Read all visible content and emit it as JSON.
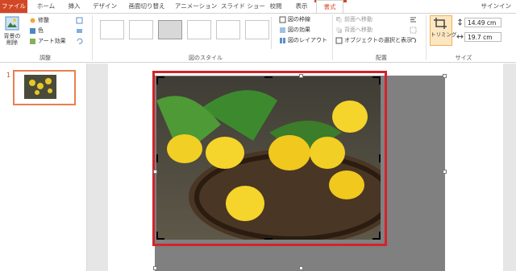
{
  "tabs": {
    "file": "ファイル",
    "home": "ホーム",
    "insert": "挿入",
    "design": "デザイン",
    "transitions": "画面切り替え",
    "animations": "アニメーション",
    "slideshow": "スライド ショー",
    "review": "校閲",
    "view": "表示",
    "format": "書式",
    "signin": "サインイン"
  },
  "adjust": {
    "remove_bg_l1": "背景の",
    "remove_bg_l2": "削除",
    "corrections": "修整",
    "color": "色",
    "artistic": "アート効果",
    "group_label": "調整"
  },
  "picture_styles": {
    "border": "図の枠線",
    "effects": "図の効果",
    "layout": "図のレイアウト",
    "group_label": "図のスタイル"
  },
  "arrange": {
    "bring_forward": "前面へ移動",
    "send_backward": "背面へ移動",
    "selection_pane": "オブジェクトの選択と表示",
    "group_label": "配置"
  },
  "size": {
    "crop": "トリミング",
    "height": "14.49 cm",
    "width": "19.7 cm",
    "group_label": "サイズ"
  },
  "slides": {
    "number": "1"
  },
  "colors": {
    "accent": "#d24726",
    "crop_frame": "#d2232a"
  }
}
